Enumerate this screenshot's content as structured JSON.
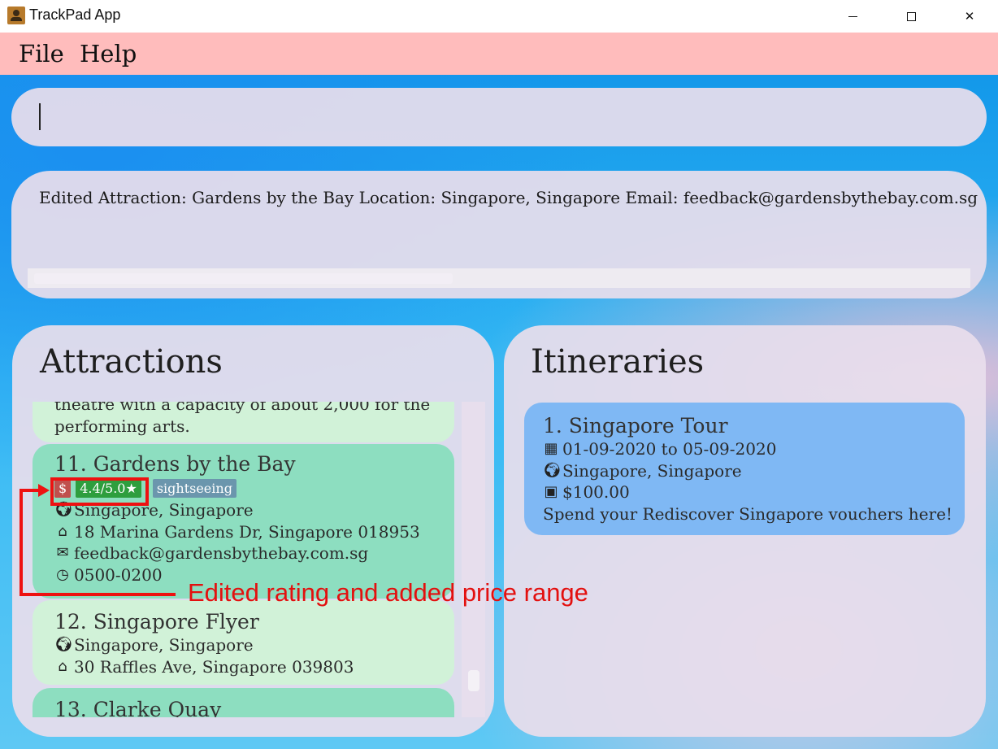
{
  "window": {
    "title": "TrackPad App",
    "minimize_icon": "minimize-icon",
    "maximize_icon": "maximize-icon",
    "close_icon": "close-icon",
    "close_glyph": "✕"
  },
  "menu": {
    "file": "File",
    "help": "Help"
  },
  "command_box": {
    "value": ""
  },
  "result_display": {
    "text": "Edited Attraction: Gardens by the Bay Location: Singapore, Singapore Email: feedback@gardensbythebay.com.sg"
  },
  "attractions": {
    "heading": "Attractions",
    "partial_card": {
      "line1": "theatre with a capacity of about 2,000 for the",
      "line2": "performing arts."
    },
    "items": [
      {
        "title": "11.  Gardens by the Bay",
        "price_tag": "$",
        "rating_tag": "4.4/5.0★",
        "category_tag": "sightseeing",
        "location": "Singapore, Singapore",
        "address": "18 Marina Gardens Dr, Singapore 018953",
        "email": "feedback@gardensbythebay.com.sg",
        "hours": "0500-0200"
      },
      {
        "title": "12.  Singapore Flyer",
        "location": "Singapore, Singapore",
        "address": "30 Raffles Ave, Singapore 039803"
      },
      {
        "title": "13.  Clarke Quay"
      }
    ]
  },
  "itineraries": {
    "heading": "Itineraries",
    "items": [
      {
        "title": "1.  Singapore Tour",
        "dates": "01-09-2020 to 05-09-2020",
        "location": "Singapore, Singapore",
        "budget": "$100.00",
        "description": "Spend your Rediscover Singapore vouchers here!"
      }
    ]
  },
  "annotation": {
    "text": "Edited rating and added price range",
    "color": "#e3100f"
  },
  "icons": {
    "globe": "🌍︎",
    "home": "⌂",
    "email": "✉",
    "clock": "◷",
    "calendar": "▦",
    "money": "▣"
  }
}
